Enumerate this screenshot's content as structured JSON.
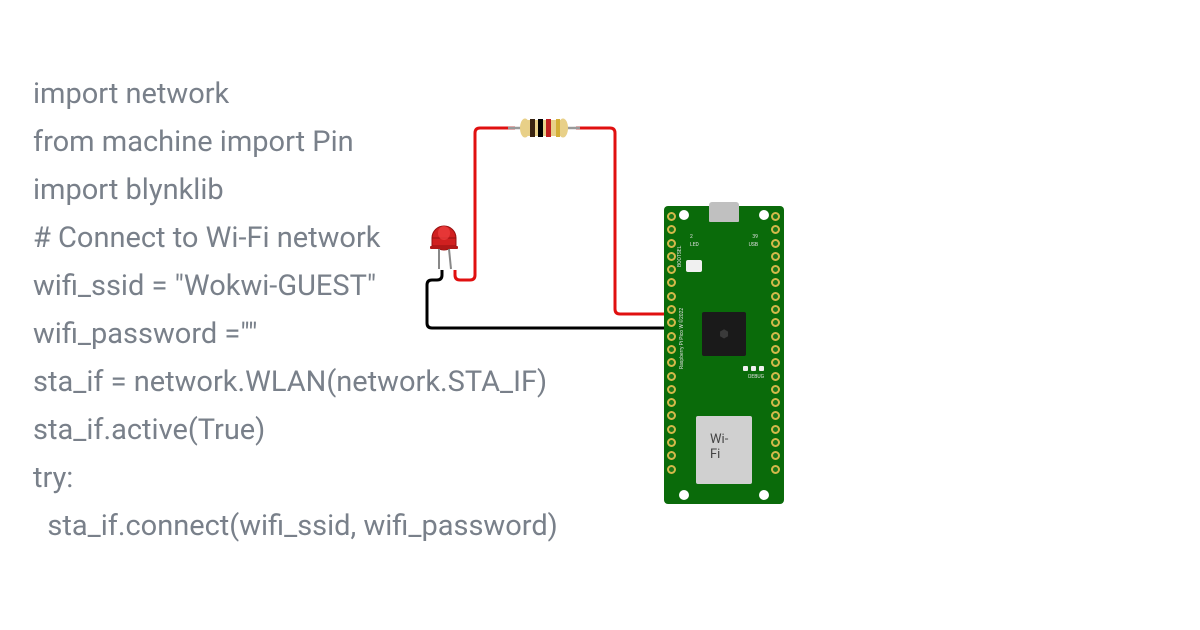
{
  "code": {
    "line1": "import network",
    "line2": "from machine import Pin",
    "line3": "import blynklib",
    "line4": "",
    "line5": "# Connect to Wi-Fi network",
    "line6": "wifi_ssid = \"Wokwi-GUEST\"",
    "line7": "wifi_password =\"\"",
    "line8": "",
    "line9": "sta_if = network.WLAN(network.STA_IF)",
    "line10": "sta_if.active(True)",
    "line11": "try:",
    "line12": "  sta_if.connect(wifi_ssid, wifi_password)"
  },
  "board": {
    "name": "Raspberry Pi Pico W ©2022",
    "wifi_label": "Wi-Fi",
    "led_label": "LED",
    "usb_label": "USB",
    "bootsel_label": "BOOTSEL",
    "debug_label": "DEBUG",
    "pin_label_2": "2",
    "pin_label_39": "39"
  },
  "components": {
    "led": {
      "type": "LED",
      "color": "#d02020"
    },
    "resistor": {
      "type": "resistor",
      "bands": [
        "#3a2410",
        "#000000",
        "#c02020",
        "#d4af37"
      ]
    }
  },
  "wires": {
    "red1": {
      "color": "#e01010"
    },
    "red2": {
      "color": "#e01010"
    },
    "black": {
      "color": "#000000"
    }
  }
}
